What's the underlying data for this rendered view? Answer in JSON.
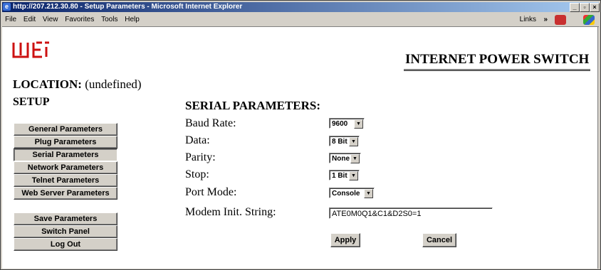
{
  "window": {
    "title": "http://207.212.30.80 - Setup Parameters - Microsoft Internet Explorer",
    "controls": [
      "_",
      "F",
      "x"
    ]
  },
  "menubar": {
    "items": [
      "File",
      "Edit",
      "View",
      "Favorites",
      "Tools",
      "Help"
    ],
    "links_label": "Links",
    "chevron": "»"
  },
  "header": {
    "logo_text": "wti",
    "brand": "INTERNET POWER SWITCH"
  },
  "location": {
    "label": "LOCATION:",
    "value": "(undefined)"
  },
  "sidebar": {
    "title": "SETUP",
    "items": [
      {
        "label": "General Parameters"
      },
      {
        "label": "Plug Parameters"
      },
      {
        "label": "Serial Parameters"
      },
      {
        "label": "Network Parameters"
      },
      {
        "label": "Telnet Parameters"
      },
      {
        "label": "Web Server Parameters"
      }
    ],
    "actions": [
      {
        "label": "Save Parameters"
      },
      {
        "label": "Switch Panel"
      },
      {
        "label": "Log Out"
      }
    ]
  },
  "main": {
    "title": "SERIAL PARAMETERS:",
    "fields": [
      {
        "label": "Baud Rate:",
        "value": "9600"
      },
      {
        "label": "Data:",
        "value": "8 Bit"
      },
      {
        "label": "Parity:",
        "value": "None"
      },
      {
        "label": "Stop:",
        "value": "1 Bit"
      },
      {
        "label": "Port Mode:",
        "value": "Console"
      },
      {
        "label": "Modem Init. String:",
        "value": "ATE0M0Q1&C1&D2S0=1"
      }
    ],
    "apply_label": "Apply",
    "cancel_label": "Cancel"
  },
  "colors": {
    "titlebar_start": "#0a246a",
    "titlebar_end": "#a6caf0",
    "logo_red": "#cc1111",
    "face": "#d4d0c8"
  }
}
